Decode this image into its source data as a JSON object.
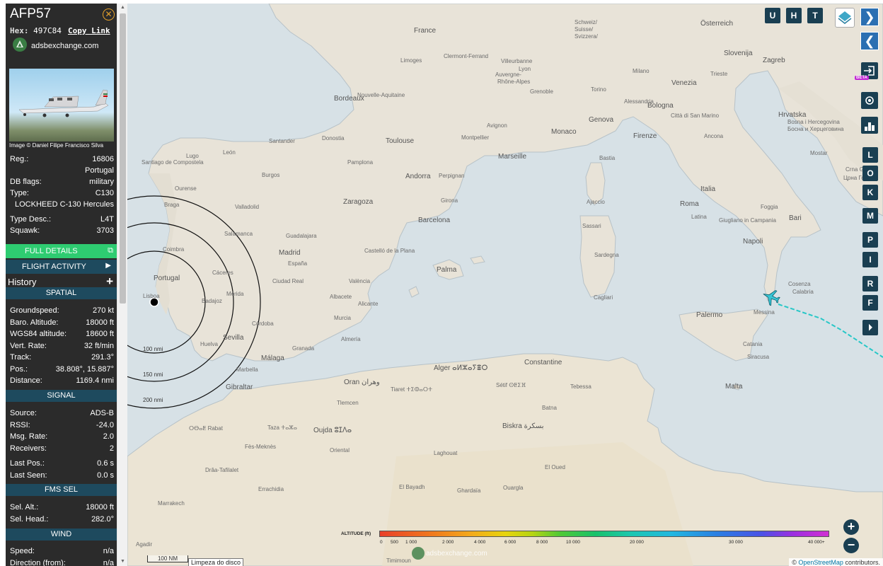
{
  "aircraft": {
    "callsign": "AFP57",
    "hex_label": "Hex:",
    "hex": "497C84",
    "copy_link": "Copy Link",
    "site": "adsbexchange.com",
    "photo_credit": "Image © Daniel Filipe Francisco Silva"
  },
  "details": {
    "reg_label": "Reg.:",
    "reg": "16806",
    "country": "Portugal",
    "dbflags_label": "DB flags:",
    "dbflags": "military",
    "type_label": "Type:",
    "type": "C130",
    "type_full": "LOCKHEED C-130 Hercules",
    "typedesc_label": "Type Desc.:",
    "typedesc": "L4T",
    "squawk_label": "Squawk:",
    "squawk": "3703"
  },
  "buttons": {
    "full_details": "FULL DETAILS",
    "flight_activity": "FLIGHT ACTIVITY",
    "history": "History"
  },
  "spatial": {
    "title": "SPATIAL",
    "rows": [
      {
        "label": "Groundspeed:",
        "value": "270 kt"
      },
      {
        "label": "Baro. Altitude:",
        "value": "18000 ft"
      },
      {
        "label": "WGS84 altitude:",
        "value": "18600 ft"
      },
      {
        "label": "Vert. Rate:",
        "value": "32 ft/min"
      },
      {
        "label": "Track:",
        "value": "291.3°"
      },
      {
        "label": "Pos.:",
        "value": "38.808°, 15.887°"
      },
      {
        "label": "Distance:",
        "value": "1169.4 nmi"
      }
    ]
  },
  "signal": {
    "title": "SIGNAL",
    "rows": [
      {
        "label": "Source:",
        "value": "ADS-B"
      },
      {
        "label": "RSSI:",
        "value": "-24.0"
      },
      {
        "label": "Msg. Rate:",
        "value": "2.0"
      },
      {
        "label": "Receivers:",
        "value": "2"
      },
      {
        "label": "Last Pos.:",
        "value": "0.6 s"
      },
      {
        "label": "Last Seen:",
        "value": "0.0 s"
      }
    ]
  },
  "fms": {
    "title": "FMS SEL",
    "rows": [
      {
        "label": "Sel. Alt.:",
        "value": "18000 ft"
      },
      {
        "label": "Sel. Head.:",
        "value": "282.0°"
      }
    ]
  },
  "wind": {
    "title": "WIND",
    "rows": [
      {
        "label": "Speed:",
        "value": "n/a"
      },
      {
        "label": "Direction (from):",
        "value": "n/a"
      }
    ]
  },
  "map": {
    "top_buttons": [
      "U",
      "H",
      "T"
    ],
    "side_buttons": [
      "L",
      "O",
      "K",
      "M",
      "P",
      "I",
      "R",
      "F"
    ],
    "beta": "BETA",
    "ring_labels": [
      "100 nmi",
      "150 nmi",
      "200 nmi"
    ],
    "scale": "100 NM",
    "tooltip": "Limpeza do disco",
    "attribution_prefix": "©",
    "attribution_link": "OpenStreetMap",
    "attribution_suffix": "contributors.",
    "altitude_title": "ALTITUDE (ft)",
    "altitude_ticks": [
      "0",
      "500",
      "1 000",
      "2 000",
      "4 000",
      "6 000",
      "8 000",
      "10 000",
      "20 000",
      "30 000",
      "40 000+"
    ],
    "watermark": "adsbexchange.com",
    "labels": {
      "france": "France",
      "schweiz": "Schweiz/",
      "suisse": "Suisse/",
      "svizzera": "Svizzera/",
      "osterreich": "Österreich",
      "slovenija": "Slovenija",
      "zagreb": "Zagreb",
      "limoges": "Limoges",
      "clermont": "Clermont-Ferrand",
      "villeurbanne": "Villeurbanne",
      "lyon": "Lyon",
      "auvergne": "Auvergne-",
      "rhone": "Rhône-Alpes",
      "bordeaux": "Bordeaux",
      "nouvelle": "Nouvelle-Aquitaine",
      "grenoble": "Grenoble",
      "torino": "Torino",
      "milano": "Milano",
      "venezia": "Venezia",
      "trieste": "Trieste",
      "alessandria": "Alessandria",
      "bologna": "Bologna",
      "genova": "Genova",
      "hrvatska": "Hrvatska",
      "toulouse": "Toulouse",
      "montpellier": "Montpellier",
      "avignon": "Avignon",
      "monaco": "Monaco",
      "firenze": "Firenze",
      "sanmarino": "Città di San Marino",
      "ancona": "Ancona",
      "bosna": "Bosna i Hercegovina",
      "bosna_cyr": "Босна и Херцеговина",
      "mostar": "Mostar",
      "marseille": "Marseille",
      "andorra": "Andorra",
      "perpignan": "Perpignan",
      "italia": "Italia",
      "roma": "Roma",
      "bastia": "Bastia",
      "ajaccio": "Ajaccio",
      "crna": "Crna Gora",
      "crna_cyr": "Црна Гора",
      "santiago": "Santiago de Compostela",
      "lugo": "Lugo",
      "leon": "León",
      "burgos": "Burgos",
      "donostia": "Donostia",
      "pamplona": "Pamplona",
      "santander": "Santander",
      "ourense": "Ourense",
      "valladolid": "Valladolid",
      "zaragoza": "Zaragoza",
      "girona": "Girona",
      "braga": "Braga",
      "salamanca": "Salamanca",
      "guadalajara": "Guadalajara",
      "barcelona": "Barcelona",
      "napoli": "Napoli",
      "bari": "Bari",
      "foggia": "Foggia",
      "latina": "Latina",
      "giugliano": "Giugliano in Campania",
      "coimbra": "Coimbra",
      "madrid": "Madrid",
      "espana": "España",
      "castellon": "Castelló de la Plana",
      "sassari": "Sassari",
      "sardegna": "Sardegna",
      "cosenza": "Cosenza",
      "portugal": "Portugal",
      "caceres": "Cáceres",
      "ciudadreal": "Ciudad Real",
      "valencia": "València",
      "palma": "Palma",
      "calabria": "Calabria",
      "lisboa": "Lisboa",
      "badajoz": "Badajoz",
      "merida": "Mérida",
      "albacete": "Albacete",
      "alicante": "Alicante",
      "murcia": "Murcia",
      "cagliari": "Cagliari",
      "messina": "Messina",
      "palermo": "Palermo",
      "cordoba": "Córdoba",
      "sevilla": "Sevilla",
      "granada": "Granada",
      "almeria": "Almería",
      "huelva": "Huelva",
      "catania": "Catania",
      "marbella": "Marbella",
      "malaga": "Málaga",
      "siracusa": "Siracusa",
      "alger": "Alger ⴰⵍⵣⴰⵢⴻⵔ",
      "constantine": "Constantine",
      "oran": "Oran وهران",
      "setif": "Sétif ⵙⵟⵉⴼ",
      "gibraltar": "Gibraltar",
      "tiaret": "Tiaret ⵜⵉⵀⴰⵔⵜ",
      "batna": "Batna",
      "tebessa": "Tebessa",
      "malta": "Malta",
      "tlemcen": "Tlemcen",
      "rabat": "ⵔⴱⴰⵟ Rabat",
      "oujda": "Oujda ⵓⵊⴷⴰ",
      "biskra": "Biskra بسكرة",
      "taza": "Taza ⵜⴰⵣⴰ",
      "fes": "Fès-Meknès",
      "oriental": "Oriental",
      "laghouat": "Laghouat",
      "eloued": "El Oued",
      "drahtafilalet": "Drâa-Tafilalet",
      "elbayadh": "El Bayadh",
      "ghardaia": "Ghardaïa",
      "ouargla": "Ouargla",
      "errachidia": "Errachidia",
      "marrakech": "Marrakech",
      "timimoun": "Timimoun",
      "agadir": "Agadir"
    }
  }
}
